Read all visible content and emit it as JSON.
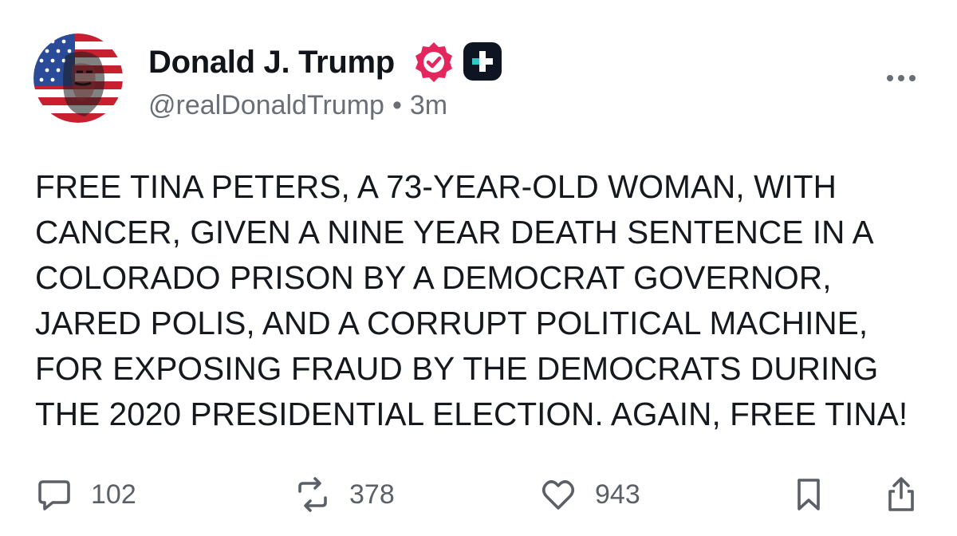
{
  "author": {
    "name": "Donald J. Trump",
    "handle": "@realDonaldTrump",
    "separator": "•",
    "time": "3m"
  },
  "icons": {
    "avatar": "avatar-flag-portrait",
    "verified": "verified-badge-icon",
    "plus": "plus-badge-icon",
    "more": "more-icon",
    "reply": "reply-icon",
    "retruth": "retruth-icon",
    "like": "heart-icon",
    "bookmark": "bookmark-icon",
    "share": "share-icon"
  },
  "colors": {
    "verified": "#e3265e",
    "plus_badge_bg": "#0e1422",
    "plus_badge_teal": "#37c3c6",
    "text": "#15181c",
    "muted": "#6a6f76"
  },
  "post": {
    "lines": [
      "FREE TINA PETERS, A 73-YEAR-OLD WOMAN, WITH",
      "CANCER, GIVEN A NINE YEAR DEATH SENTENCE IN A",
      "COLORADO PRISON BY A DEMOCRAT GOVERNOR,",
      "JARED POLIS, AND A CORRUPT POLITICAL MACHINE,",
      "FOR EXPOSING FRAUD BY THE DEMOCRATS DURING",
      "THE 2020 PRESIDENTIAL ELECTION. AGAIN, FREE TINA!"
    ]
  },
  "actions": {
    "replies": "102",
    "retruths": "378",
    "likes": "943"
  }
}
